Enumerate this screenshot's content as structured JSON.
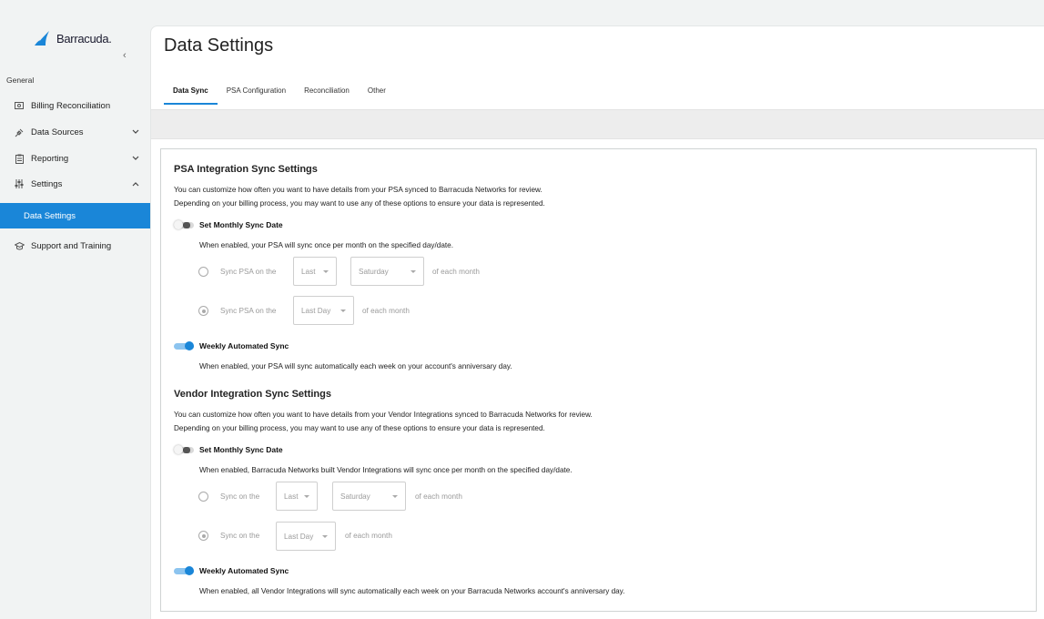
{
  "brand": {
    "name": "Barracuda.",
    "color": "#1a86d8"
  },
  "sidebar": {
    "section_label": "General",
    "collapse_glyph": "‹",
    "items": [
      {
        "label": "Billing Reconciliation",
        "icon": "billing-icon"
      },
      {
        "label": "Data Sources",
        "icon": "plug-icon",
        "chevron": "⌄"
      },
      {
        "label": "Reporting",
        "icon": "clipboard-icon",
        "chevron": "⌄"
      },
      {
        "label": "Settings",
        "icon": "sliders-icon",
        "chevron": "⌃"
      },
      {
        "label": "Data Settings",
        "active": true
      },
      {
        "label": "Support and Training",
        "icon": "graduation-cap-icon"
      }
    ]
  },
  "page": {
    "title": "Data Settings",
    "tabs": [
      "Data Sync",
      "PSA Configuration",
      "Reconciliation",
      "Other"
    ],
    "active_tab": "Data Sync"
  },
  "psa": {
    "title": "PSA Integration Sync Settings",
    "desc1": "You can customize how often you want to have details from your PSA synced to Barracuda Networks for review.",
    "desc2": "Depending on your billing process, you may want to use any of these options to ensure your data is represented.",
    "monthly_label": "Set Monthly Sync Date",
    "monthly_enabled": false,
    "monthly_desc": "When enabled, your PSA will sync once per month on the specified day/date.",
    "option1_prefix": "Sync PSA on the",
    "option1_week": "Last",
    "option1_day": "Saturday",
    "option1_suffix": "of each month",
    "option2_prefix": "Sync PSA on the",
    "option2_day": "Last Day",
    "option2_suffix": "of each month",
    "weekly_label": "Weekly Automated Sync",
    "weekly_enabled": true,
    "weekly_desc": "When enabled, your PSA will sync automatically each week on your account's anniversary day."
  },
  "vendor": {
    "title": "Vendor Integration Sync Settings",
    "desc1": "You can customize how often you want to have details from your Vendor Integrations synced to Barracuda Networks for review.",
    "desc2": "Depending on your billing process, you may want to use any of these options to ensure your data is represented.",
    "monthly_label": "Set Monthly Sync Date",
    "monthly_enabled": false,
    "monthly_desc": "When enabled, Barracuda Networks built Vendor Integrations will sync once per month on the specified day/date.",
    "option1_prefix": "Sync on the",
    "option1_week": "Last",
    "option1_day": "Saturday",
    "option1_suffix": "of each month",
    "option2_prefix": "Sync on the",
    "option2_day": "Last Day",
    "option2_suffix": "of each month",
    "weekly_label": "Weekly Automated Sync",
    "weekly_enabled": true,
    "weekly_desc": "When enabled, all Vendor Integrations will sync automatically each week on your Barracuda Networks account's anniversary day."
  }
}
